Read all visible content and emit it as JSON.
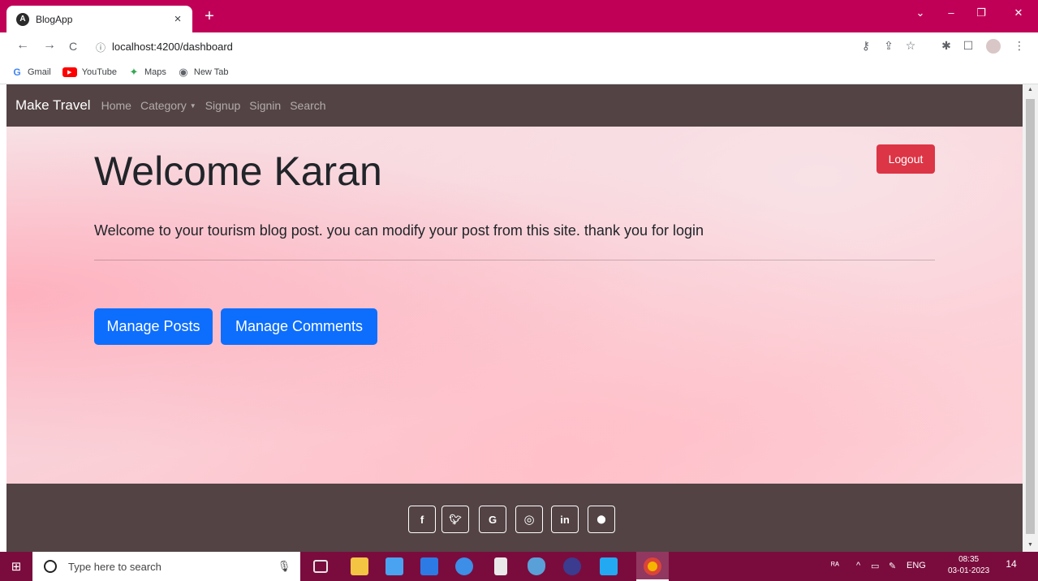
{
  "browser": {
    "tab_title": "BlogApp",
    "tab_favicon": "A",
    "tab_close": "×",
    "new_tab": "+",
    "window_controls": [
      "⌄",
      "–",
      "❐",
      "✕"
    ],
    "nav": {
      "back": "←",
      "forward": "→",
      "reload": "C"
    },
    "url_info": "ⓘ",
    "url": "localhost:4200/dashboard",
    "toolbar_icons": [
      "key-icon",
      "share-icon",
      "star-icon",
      "extensions-icon",
      "sidepanel-icon",
      "profile-icon",
      "menu-icon"
    ],
    "toolbar_glyphs": [
      "⚷",
      "⇪",
      "☆",
      "✱",
      "☐",
      "⋮"
    ],
    "bookmarks": [
      {
        "label": "Gmail",
        "icon": "google-icon",
        "glyph": "G",
        "color": "#4285f4"
      },
      {
        "label": "YouTube",
        "icon": "youtube-icon",
        "glyph": "▶",
        "color": "#ff0000"
      },
      {
        "label": "Maps",
        "icon": "maps-icon",
        "glyph": "✦",
        "color": "#34a853"
      },
      {
        "label": "New Tab",
        "icon": "globe-icon",
        "glyph": "◉",
        "color": "#5f6368"
      }
    ]
  },
  "navbar": {
    "brand": "Make Travel",
    "links": [
      "Home",
      "Category",
      "Signup",
      "Signin",
      "Search"
    ],
    "caret": "▼"
  },
  "main": {
    "title": "Welcome Karan",
    "logout_label": "Logout",
    "lead": "Welcome to your tourism blog post. you can modify your post from this site. thank you for login",
    "manage_posts_label": "Manage Posts",
    "manage_comments_label": "Manage Comments"
  },
  "footer": {
    "social": [
      {
        "name": "facebook-icon",
        "glyph": "f"
      },
      {
        "name": "twitter-icon",
        "glyph": "🐦︎"
      },
      {
        "name": "google-icon",
        "glyph": "G"
      },
      {
        "name": "instagram-icon",
        "glyph": "◎"
      },
      {
        "name": "linkedin-icon",
        "glyph": "in"
      },
      {
        "name": "github-icon",
        "glyph": "⬤"
      }
    ]
  },
  "taskbar": {
    "search_placeholder": "Type here to search",
    "start_glyph": "⊞",
    "mic_glyph": "🎙︎",
    "apps": [
      {
        "name": "task-view-icon",
        "color": "#cfcfcf"
      },
      {
        "name": "file-explorer-icon",
        "color": "#f4c542"
      },
      {
        "name": "store-icon",
        "color": "#4aa3f0"
      },
      {
        "name": "mail-icon",
        "color": "#2c7be5"
      },
      {
        "name": "edge-icon",
        "color": "#3c8ee6"
      },
      {
        "name": "notepad-icon",
        "color": "#e9e9e9"
      },
      {
        "name": "java-icon",
        "color": "#5aa0d8"
      },
      {
        "name": "eclipse-icon",
        "color": "#3b3b8f"
      },
      {
        "name": "vscode-icon",
        "color": "#23a9f2"
      },
      {
        "name": "chrome-icon",
        "color": "#f5b400"
      }
    ],
    "tray_items": [
      "ᴿᴬ",
      "^",
      "▭",
      "✎",
      "ENG"
    ],
    "time": "08:35",
    "date": "03-01-2023",
    "notifications": "14"
  },
  "colors": {
    "tabbar": "#c00057",
    "navbar": "#534344",
    "logout": "#dc3545",
    "primary": "#0d6efd",
    "taskbar": "#7a0c3d"
  }
}
